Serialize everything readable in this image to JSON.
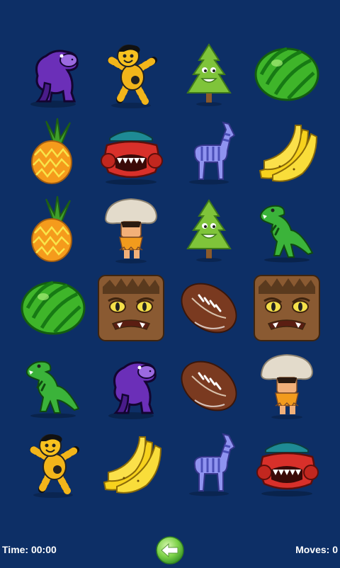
{
  "status": {
    "time_label": "Time: 00:00",
    "moves_label": "Moves: 0"
  },
  "back_button": {
    "icon": "back-arrow-icon"
  },
  "grid": {
    "rows": 6,
    "cols": 4,
    "cards": [
      "gorilla",
      "robot-kid",
      "tree",
      "watermelon",
      "pineapple",
      "monster-car",
      "zebra",
      "banana",
      "pineapple",
      "mushroom-caveman",
      "tree",
      "dinosaur",
      "watermelon",
      "werewolf",
      "football",
      "werewolf",
      "dinosaur",
      "gorilla",
      "football",
      "mushroom-caveman",
      "robot-kid",
      "banana",
      "zebra",
      "monster-car"
    ]
  },
  "colors": {
    "background": "#0d2f66",
    "accent_green": "#5bc33a"
  }
}
